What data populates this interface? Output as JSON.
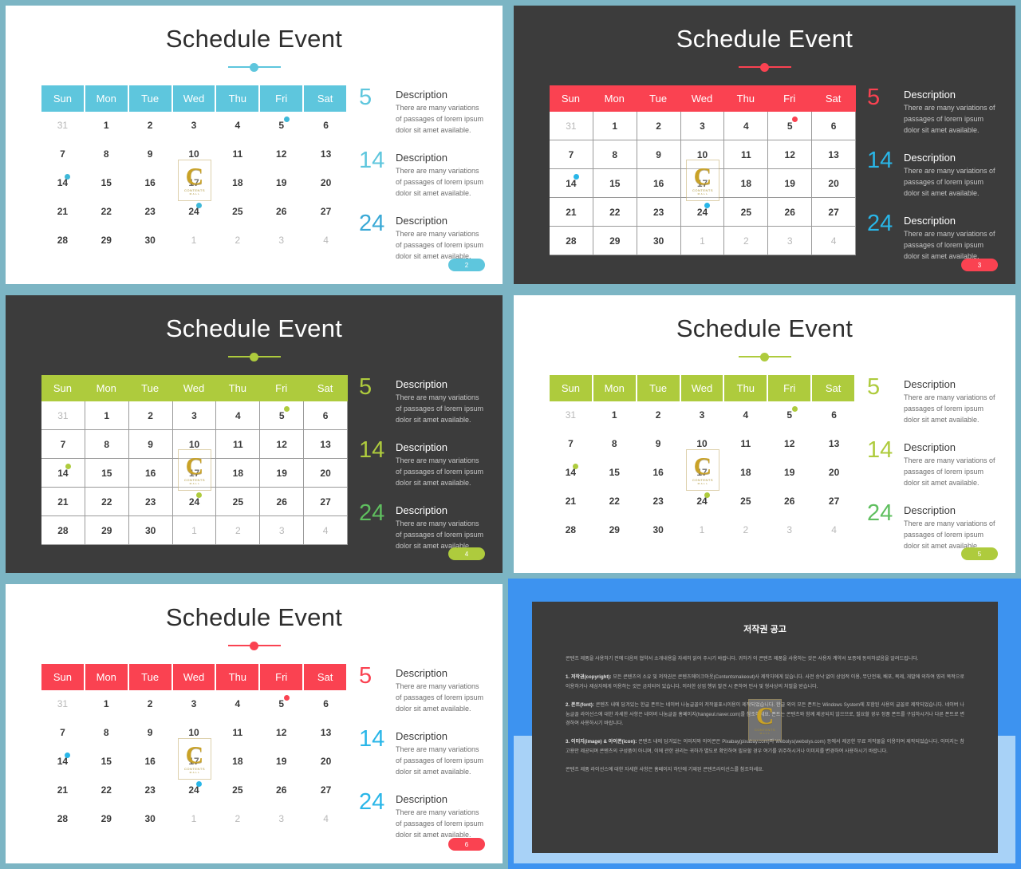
{
  "common": {
    "title": "Schedule Event",
    "weekdays": [
      "Sun",
      "Mon",
      "Tue",
      "Wed",
      "Thu",
      "Fri",
      "Sat"
    ],
    "weeks": [
      [
        "31",
        "1",
        "2",
        "3",
        "4",
        "5",
        "6"
      ],
      [
        "7",
        "8",
        "9",
        "10",
        "11",
        "12",
        "13"
      ],
      [
        "14",
        "15",
        "16",
        "17",
        "18",
        "19",
        "20"
      ],
      [
        "21",
        "22",
        "23",
        "24",
        "25",
        "26",
        "27"
      ],
      [
        "28",
        "29",
        "30",
        "1",
        "2",
        "3",
        "4"
      ]
    ],
    "muted_cells": [
      "0-0",
      "4-3",
      "4-4",
      "4-5",
      "4-6"
    ],
    "event_cells": [
      "0-5",
      "2-0",
      "3-3"
    ],
    "desc_numbers": [
      "5",
      "14",
      "24"
    ],
    "desc_heading": "Description",
    "desc_body": "There are many variations of passages of lorem ipsum dolor sit amet available.",
    "watermark_letter": "C",
    "watermark_label": "CONTENTS",
    "watermark_sub": "M A L L"
  },
  "colors": {
    "frame_teal": "#7cb5c4",
    "cyan": "#5ec6dd",
    "red": "#fa4251",
    "green": "#aecb3d",
    "green_alt": "#5fbf5f",
    "dark_bg": "#3c3c3c",
    "light_bg": "#ffffff",
    "row_light": "#eaeaea",
    "row_dark": "#c9c9c9",
    "copy_blue": "#3d93f0",
    "copy_blue_light": "#a8d2f7"
  },
  "slides": [
    {
      "id": "slide-2",
      "theme": "light",
      "grid_style": "flat",
      "accent": "#5ec6dd",
      "header_color": "#5ec6dd",
      "dot_color": "#3fb8d8",
      "num_colors": [
        "#5ec6dd",
        "#5ec6dd",
        "#3aa9d6"
      ],
      "badge_color": "#5ec6dd",
      "page_number": "2"
    },
    {
      "id": "slide-3",
      "theme": "dark",
      "grid_style": "bord",
      "accent": "#fa4251",
      "header_color": "#fa4251",
      "dot_colors": [
        "#fa4251",
        "#29b6e8",
        "#29b6e8"
      ],
      "num_colors": [
        "#fa4251",
        "#29b6e8",
        "#29b6e8"
      ],
      "badge_color": "#fa4251",
      "page_number": "3"
    },
    {
      "id": "slide-4",
      "theme": "dark",
      "grid_style": "bord",
      "accent": "#aecb3d",
      "header_color": "#aecb3d",
      "dot_color": "#aecb3d",
      "num_colors": [
        "#aecb3d",
        "#aecb3d",
        "#5fbf5f"
      ],
      "badge_color": "#aecb3d",
      "page_number": "4"
    },
    {
      "id": "slide-5",
      "theme": "light",
      "grid_style": "flat",
      "accent": "#aecb3d",
      "header_color": "#aecb3d",
      "dot_color": "#aecb3d",
      "num_colors": [
        "#aecb3d",
        "#aecb3d",
        "#5fbf5f"
      ],
      "badge_color": "#aecb3d",
      "page_number": "5"
    },
    {
      "id": "slide-6",
      "theme": "light",
      "grid_style": "flat",
      "accent": "#fa4251",
      "header_color": "#fa4251",
      "dot_colors": [
        "#fa4251",
        "#29b6e8",
        "#29b6e8"
      ],
      "num_colors": [
        "#fa4251",
        "#29b6e8",
        "#29b6e8"
      ],
      "badge_color": "#fa4251",
      "page_number": "6"
    }
  ],
  "copyright": {
    "title": "저작권 공고",
    "paragraphs": [
      "콘텐츠 제품을 사용하기 전에 다음의 협약서 소개내용을 자세히 읽어 주시기 바랍니다. 귀하가 이 콘텐츠 제품을 사용하는 것은 사용자 계약서 보증에 동의하셨음을 알려드립니다.",
      "<b>1. 저작권(copyright):</b> 모든 콘텐츠의 소유 및 저작권은 콘텐츠메이크아웃(Contentsmakeout)사 제작자에게 있습니다. 사전 승낙 없이 상업적 이용, 무단전재, 배포, 복제, 개발에 의하여 영리 목적으로 이용하거나 제삼자에게 이용하는 것은 금지되어 있습니다. 이러한 상업 행위 발견 시 준하여 민사 및 형사상의 처벌을 받습니다.",
      "<b>2. 폰트(font):</b> 콘텐츠 내에 담겨있는 한글 폰트는 네이버 나눔글꼴의 저작물표시이용이 제작되었습니다. 한글 외의 모든 폰트는 Windows System에 포함된 사용의 글꼴로 제작되었습니다. 네이버 나눔글꼴 라이선스에 대한 자세한 사항은 네이버 나눔글꼴 홈페이지(hangeul.naver.com)를 참조하세요. 폰트는 콘텐츠와 함께 제공되지 않으므로, 필요할 경우 정품 폰트를 구입하시거나 다른 폰트로 변경하여 사용하시기 바랍니다.",
      "<b>3. 이미지(image) & 아이콘(icon):</b> 콘텐츠 내에 담겨있는 이미지와 아이콘은 Pixabay(pixabay.com)와 Webolys(webolys.com) 등에서 제공한 무료 저작물을 이용하여 제작되었습니다. 이미지는 참고용만 제공되며 콘텐츠의 구성품이 아니며, 이에 관한 권리는 귀하가 별도로 확인하여 필요할 경우 여기를 위주하시거나 이미지를 변경하여 사용하시기 바랍니다.",
      "콘텐츠 제품 라이선스에 대한 자세한 사항은 홈페이지 하단에 기재된 콘텐츠라이선스를 참조하세요."
    ]
  }
}
